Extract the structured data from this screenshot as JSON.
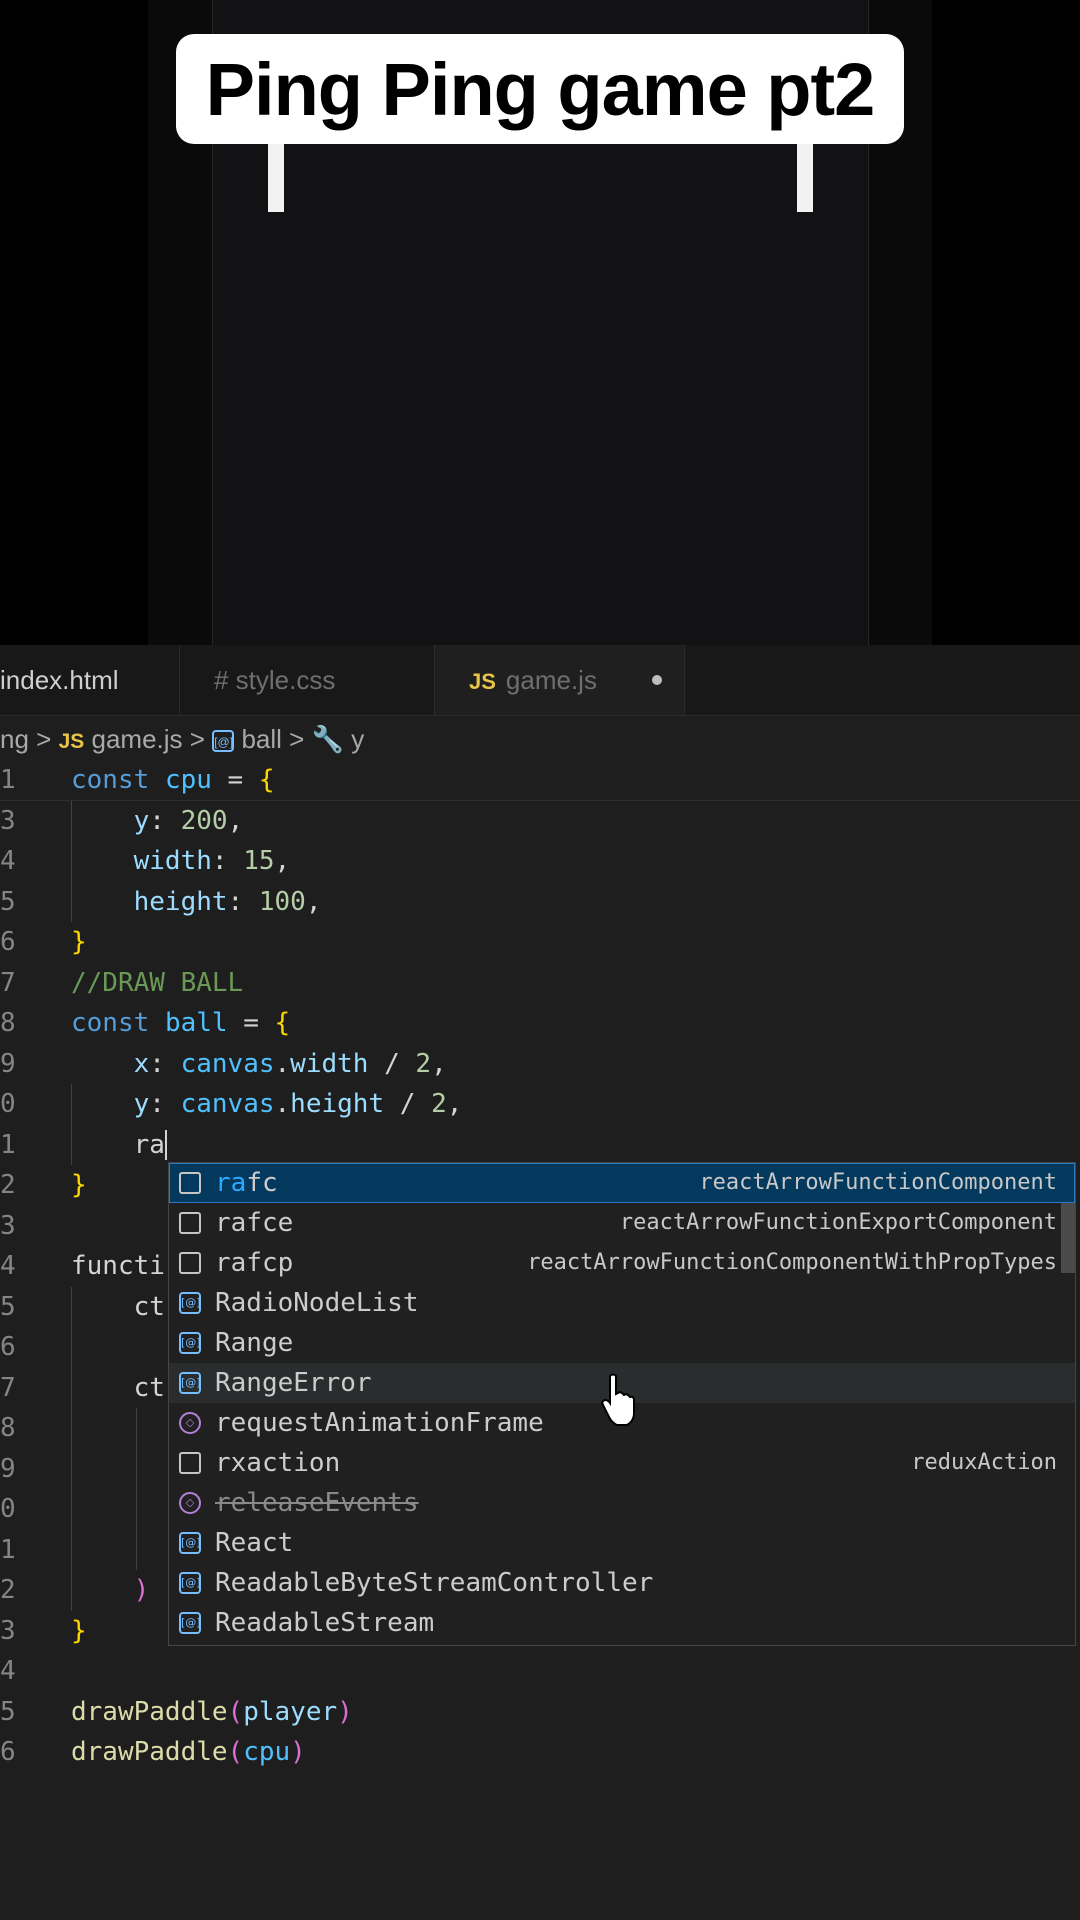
{
  "video": {
    "title": "Ping Ping game pt2"
  },
  "tabs": [
    {
      "label": "index.html"
    },
    {
      "label": "# style.css"
    },
    {
      "label": "game.js",
      "badge": "JS"
    }
  ],
  "breadcrumb": {
    "folder": "ng",
    "file_badge": "JS",
    "file": "game.js",
    "symbol": "ball",
    "property": "y"
  },
  "code_lines": [
    {
      "ln": "1",
      "text": "const cpu = {"
    },
    {
      "ln": "3",
      "text": "    y: 200,"
    },
    {
      "ln": "4",
      "text": "    width: 15,"
    },
    {
      "ln": "5",
      "text": "    height: 100,"
    },
    {
      "ln": "6",
      "text": "}"
    },
    {
      "ln": "7",
      "text": "//DRAW BALL"
    },
    {
      "ln": "8",
      "text": "const ball = {"
    },
    {
      "ln": "9",
      "text": "    x: canvas.width / 2,"
    },
    {
      "ln": "0",
      "text": "    y: canvas.height / 2,"
    },
    {
      "ln": "1",
      "text": "    ra"
    },
    {
      "ln": "2",
      "text": "}"
    },
    {
      "ln": "3",
      "text": ""
    },
    {
      "ln": "4",
      "text": "functi"
    },
    {
      "ln": "5",
      "text": "    ct"
    },
    {
      "ln": "6",
      "text": ""
    },
    {
      "ln": "7",
      "text": "    ct"
    },
    {
      "ln": "8",
      "text": ""
    },
    {
      "ln": "9",
      "text": ""
    },
    {
      "ln": "0",
      "text": ""
    },
    {
      "ln": "1",
      "text": ""
    },
    {
      "ln": "2",
      "text": "    )"
    },
    {
      "ln": "3",
      "text": "}"
    },
    {
      "ln": "4",
      "text": ""
    },
    {
      "ln": "5",
      "text": "drawPaddle(player)"
    },
    {
      "ln": "6",
      "text": "drawPaddle(cpu)"
    }
  ],
  "suggestions": [
    {
      "match": "ra",
      "rest": "fc",
      "icon": "snippet-icon",
      "detail": "reactArrowFunctionComponent",
      "selected": true
    },
    {
      "match": "",
      "rest": "rafce",
      "icon": "snippet-icon",
      "detail": "reactArrowFunctionExportComponent"
    },
    {
      "match": "",
      "rest": "rafcp",
      "icon": "snippet-icon",
      "detail": "reactArrowFunctionComponentWithPropTypes"
    },
    {
      "match": "",
      "rest": "RadioNodeList",
      "icon": "variable-icon",
      "detail": ""
    },
    {
      "match": "",
      "rest": "Range",
      "icon": "variable-icon",
      "detail": ""
    },
    {
      "match": "",
      "rest": "RangeError",
      "icon": "variable-icon",
      "detail": "",
      "hovered": true
    },
    {
      "match": "",
      "rest": "requestAnimationFrame",
      "icon": "method-icon",
      "detail": ""
    },
    {
      "match": "",
      "rest": "rxaction",
      "icon": "snippet-icon",
      "detail": "reduxAction"
    },
    {
      "match": "",
      "rest": "releaseEvents",
      "icon": "method-icon",
      "detail": "",
      "deprecated": true
    },
    {
      "match": "",
      "rest": "React",
      "icon": "variable-icon",
      "detail": ""
    },
    {
      "match": "",
      "rest": "ReadableByteStreamController",
      "icon": "variable-icon",
      "detail": ""
    },
    {
      "match": "",
      "rest": "ReadableStream",
      "icon": "variable-icon",
      "detail": ""
    }
  ],
  "colors": {
    "keyword": "#569cd6",
    "variable": "#4fc1ff",
    "property": "#9cdcfe",
    "number": "#b5cea8",
    "comment": "#6a9955",
    "function": "#dcdcaa",
    "bracket1": "#ffd700",
    "bracket2": "#da70d6",
    "match": "#2aaaff",
    "selection": "#04395e"
  }
}
